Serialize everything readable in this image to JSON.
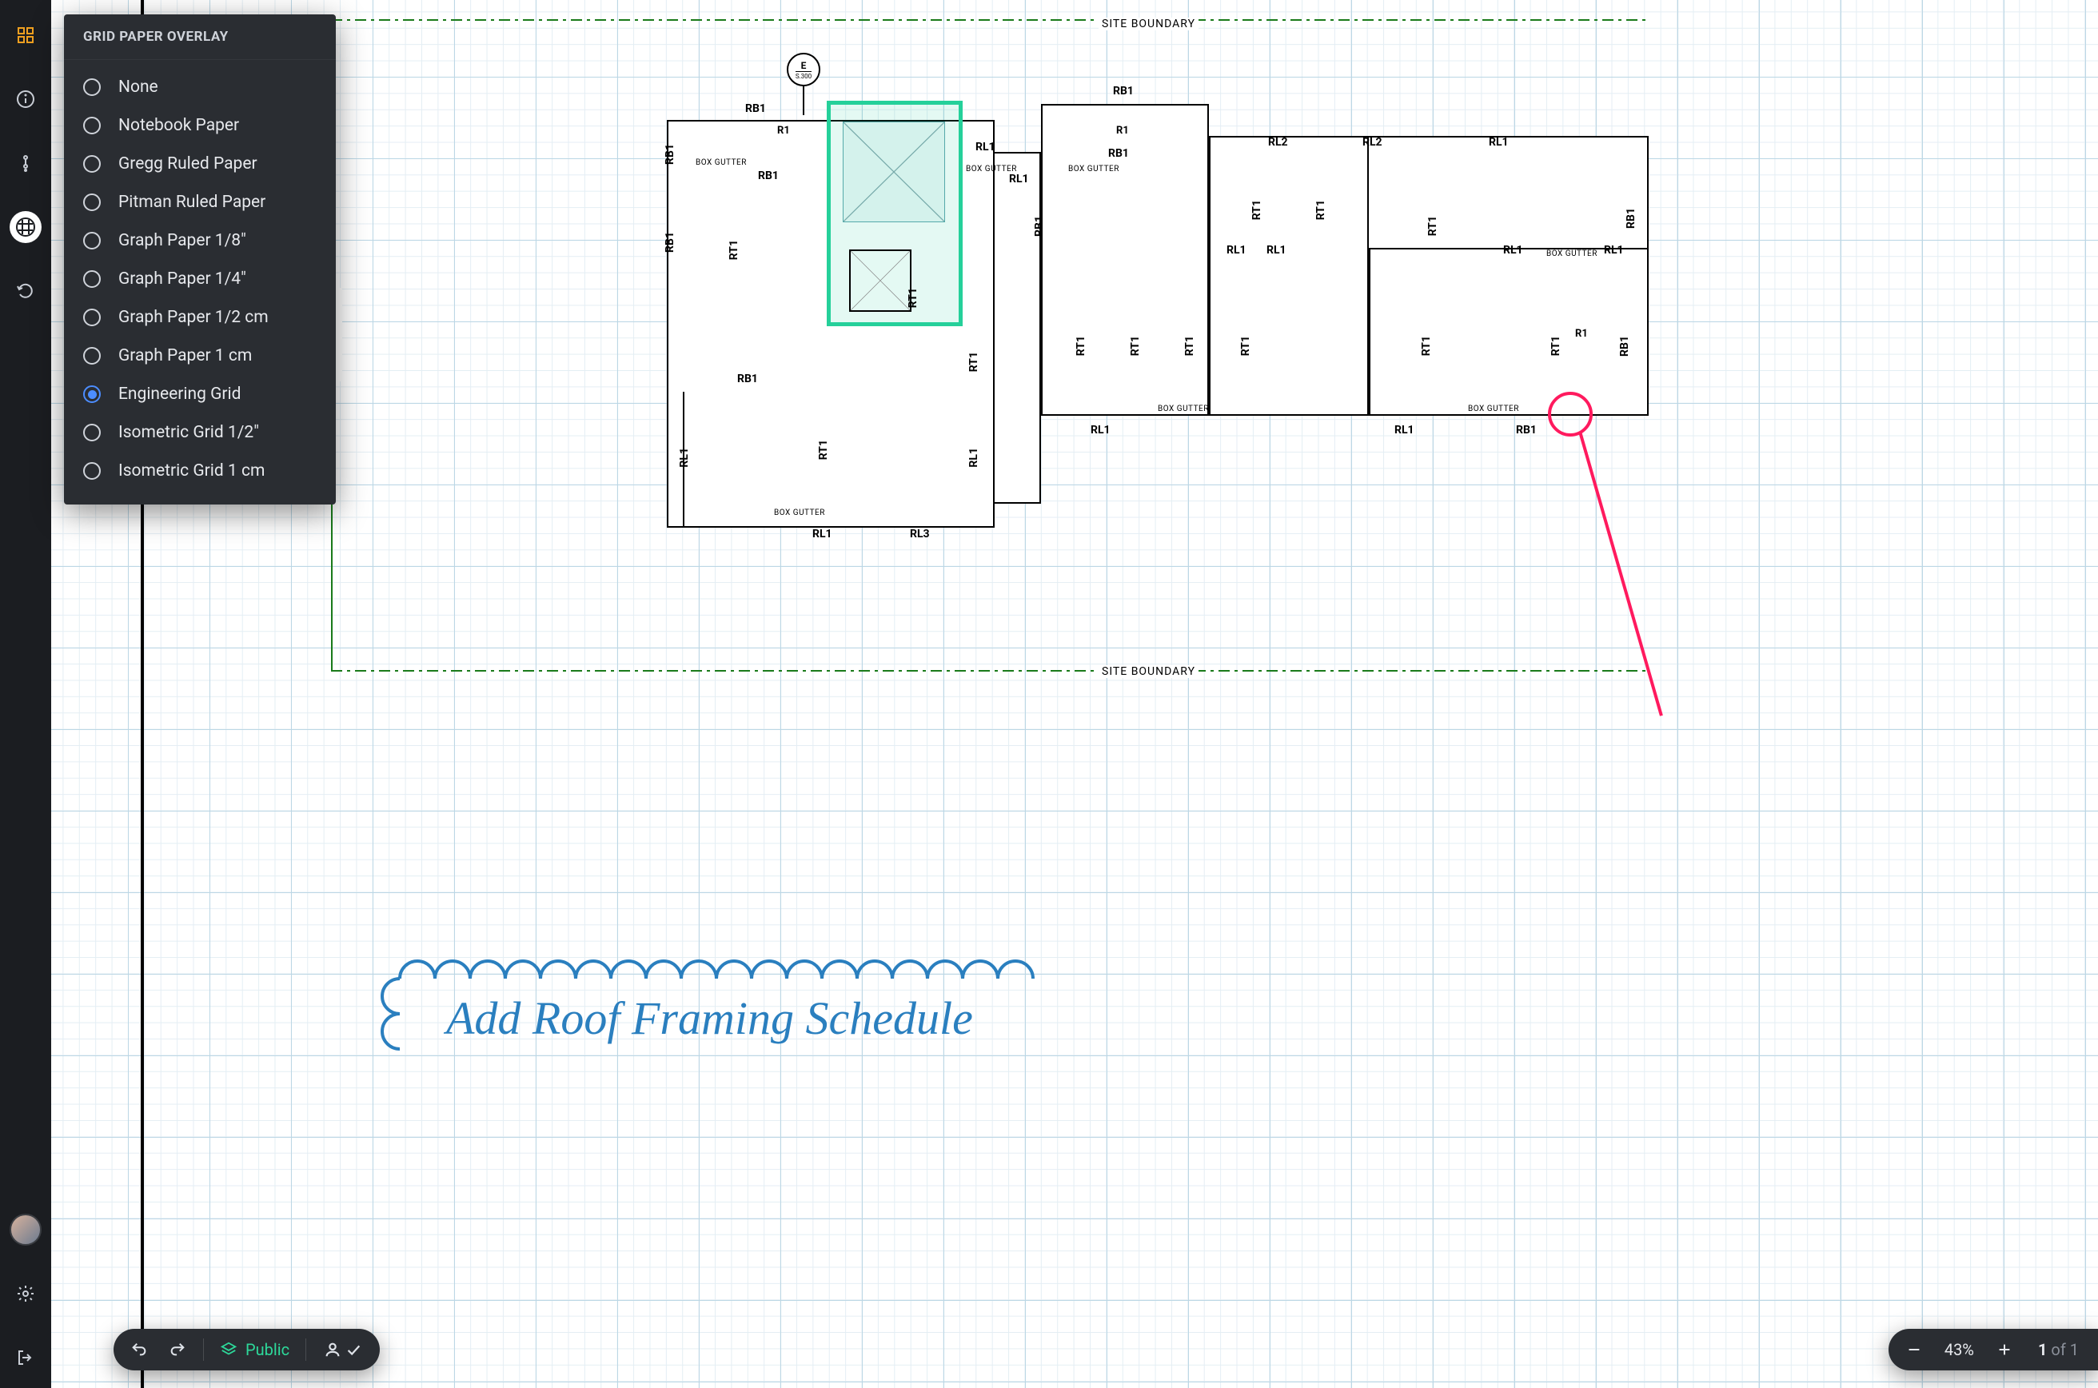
{
  "grid_panel": {
    "title": "GRID PAPER OVERLAY",
    "options": [
      "None",
      "Notebook Paper",
      "Gregg Ruled Paper",
      "Pitman Ruled Paper",
      "Graph Paper 1/8\"",
      "Graph Paper 1/4\"",
      "Graph Paper 1/2 cm",
      "Graph Paper 1 cm",
      "Engineering Grid",
      "Isometric Grid 1/2\"",
      "Isometric Grid 1 cm"
    ],
    "selected_index": 8
  },
  "site": {
    "label": "SITE BOUNDARY"
  },
  "section_bubble": {
    "letter": "E",
    "sheet": "S.300"
  },
  "plan_labels": {
    "RB1": "RB1",
    "RT1": "RT1",
    "RL1": "RL1",
    "RL2": "RL2",
    "RL3": "RL3",
    "R1": "R1",
    "box_gutter": "BOX GUTTER"
  },
  "annotation": {
    "text": "Add  Roof  Framing  Schedule"
  },
  "toolbar": {
    "public_label": "Public"
  },
  "zoom": {
    "percent": "43%",
    "page_current": "1",
    "page_of": "of",
    "page_total": "1"
  }
}
